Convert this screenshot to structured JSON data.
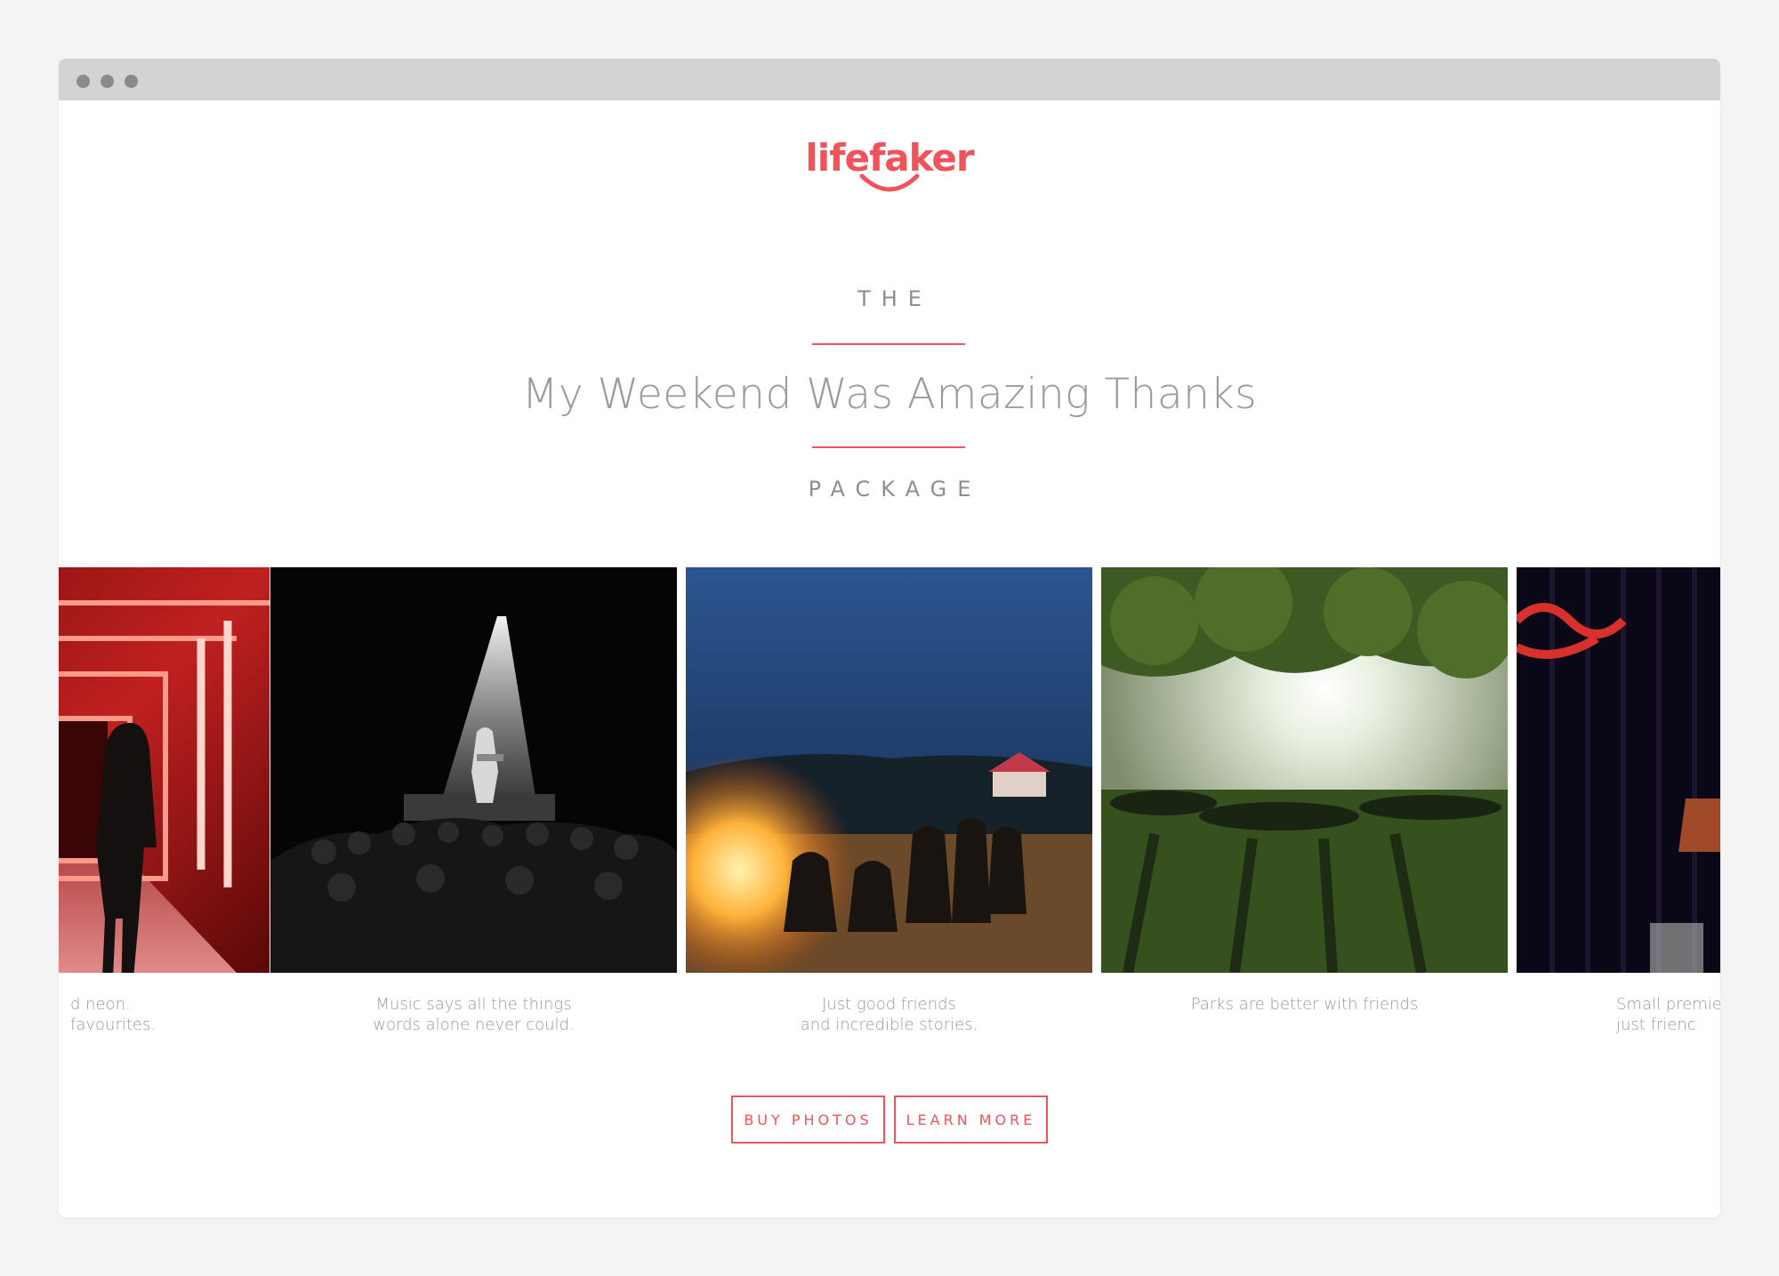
{
  "brand": {
    "name": "lifefaker",
    "accent": "#f0535a"
  },
  "hero": {
    "eyebrow_top": "THE",
    "title": "My Weekend Was Amazing Thanks",
    "eyebrow_bottom": "PACKAGE"
  },
  "gallery": [
    {
      "caption": "d neon.\nfavourites.",
      "icon": "neon-corridor-photo"
    },
    {
      "caption": "Music says all the things\nwords alone never could.",
      "icon": "concert-photo"
    },
    {
      "caption": "Just good friends\nand incredible stories.",
      "icon": "bonfire-photo"
    },
    {
      "caption": "Parks are better with friends",
      "icon": "park-photo"
    },
    {
      "caption": "Small premier\njust frienc",
      "icon": "cinema-photo"
    }
  ],
  "actions": {
    "buy_label": "BUY PHOTOS",
    "learn_label": "LEARN MORE"
  }
}
